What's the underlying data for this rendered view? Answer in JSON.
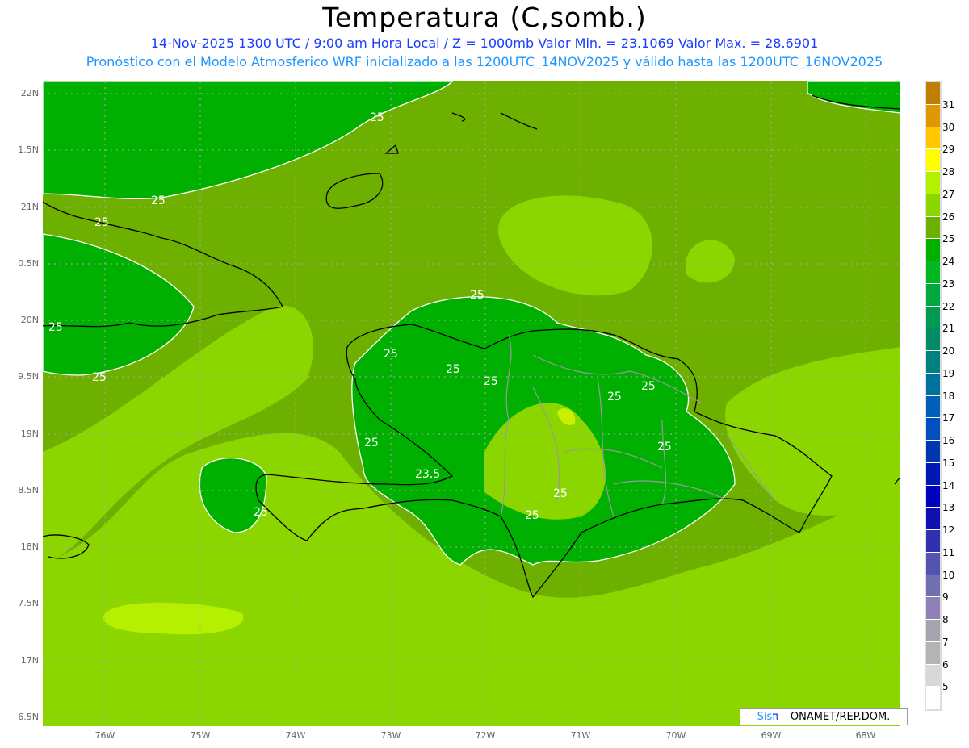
{
  "header": {
    "title": "Temperatura (C,somb.)",
    "subtitle_line1": "14-Nov-2025  1300 UTC / 9:00 am Hora Local / Z = 1000mb    Valor Min. = 23.1069   Valor Max. = 28.6901",
    "subtitle_line2": "Pronóstico con el Modelo Atmosferico WRF inicializado a las 1200UTC_14NOV2025 y válido hasta las  1200UTC_16NOV2025"
  },
  "axes": {
    "lat_labels": [
      "22N",
      "1.5N",
      "21N",
      "0.5N",
      "20N",
      "9.5N",
      "19N",
      "8.5N",
      "18N",
      "7.5N",
      "17N",
      "6.5N"
    ],
    "lon_labels": [
      "76W",
      "75W",
      "74W",
      "73W",
      "72W",
      "71W",
      "70W",
      "69W",
      "68W"
    ]
  },
  "contour_labels": [
    "25",
    "25",
    "25",
    "25",
    "25",
    "25",
    "25",
    "25",
    "25",
    "25",
    "25",
    "25",
    "25",
    "25",
    "25",
    "23.5",
    "25"
  ],
  "colorbar": {
    "labels": [
      "31",
      "30",
      "29",
      "28",
      "27",
      "26",
      "25",
      "24",
      "23",
      "22",
      "21",
      "20",
      "19",
      "18",
      "17",
      "16",
      "15",
      "14",
      "13",
      "12",
      "11",
      "10",
      "9",
      "8",
      "7",
      "6",
      "5"
    ],
    "colors": [
      "#bf7f00",
      "#e09800",
      "#ffc800",
      "#ffff00",
      "#b4f000",
      "#8cd600",
      "#6eb000",
      "#00b000",
      "#00b820",
      "#00a840",
      "#009a50",
      "#008c64",
      "#008080",
      "#00709c",
      "#0060b8",
      "#0050c0",
      "#0036b0",
      "#0018b4",
      "#0000c0",
      "#1010b0",
      "#3030b0",
      "#5454b0",
      "#7070b0",
      "#9080b8",
      "#a4a4ac",
      "#b4b4b4",
      "#d8d8d8",
      "#ffffff"
    ]
  },
  "credit": {
    "brand": "Sis",
    "pi": "π",
    "text": "– ONAMET/REP.DOM."
  }
}
